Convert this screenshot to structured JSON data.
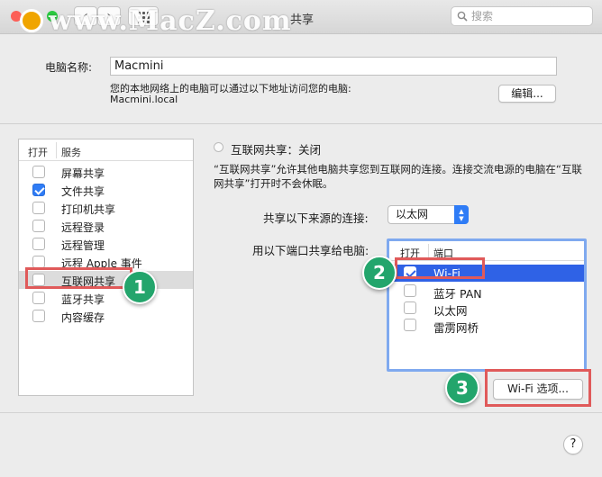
{
  "window": {
    "title": "共享",
    "search_placeholder": "搜索",
    "watermark_text": "www.MacZ.com"
  },
  "computer": {
    "name_label": "电脑名称:",
    "name_value": "Macmini",
    "address_hint": "您的本地网络上的电脑可以通过以下地址访问您的电脑:",
    "address": "Macmini.local",
    "edit_button": "编辑..."
  },
  "services": {
    "header_on": "打开",
    "header_service": "服务",
    "items": [
      {
        "label": "屏幕共享",
        "checked": false
      },
      {
        "label": "文件共享",
        "checked": true
      },
      {
        "label": "打印机共享",
        "checked": false
      },
      {
        "label": "远程登录",
        "checked": false
      },
      {
        "label": "远程管理",
        "checked": false
      },
      {
        "label": "远程 Apple 事件",
        "checked": false
      },
      {
        "label": "互联网共享",
        "checked": false,
        "selected": true
      },
      {
        "label": "蓝牙共享",
        "checked": false
      },
      {
        "label": "内容缓存",
        "checked": false
      }
    ]
  },
  "internet_sharing": {
    "status": "互联网共享：关闭",
    "description": "“互联网共享”允许其他电脑共享您到互联网的连接。连接交流电源的电脑在“互联网共享”打开时不会休眠。",
    "source_label": "共享以下来源的连接:",
    "source_value": "以太网",
    "ports_label": "用以下端口共享给电脑:",
    "ports_header_on": "打开",
    "ports_header_port": "端口",
    "ports": [
      {
        "label": "Wi-Fi",
        "checked": true,
        "selected": true
      },
      {
        "label": "蓝牙 PAN",
        "checked": false
      },
      {
        "label": "以太网",
        "checked": false
      },
      {
        "label": "雷雳网桥",
        "checked": false
      }
    ],
    "wifi_options_button": "Wi-Fi 选项..."
  },
  "annotations": {
    "step1": "1",
    "step2": "2",
    "step3": "3",
    "box_color": "#e05a5a",
    "marker_color": "#23a56c"
  },
  "help_label": "?",
  "colors": {
    "accent": "#2f7cf6",
    "selection": "#2f62e6"
  }
}
